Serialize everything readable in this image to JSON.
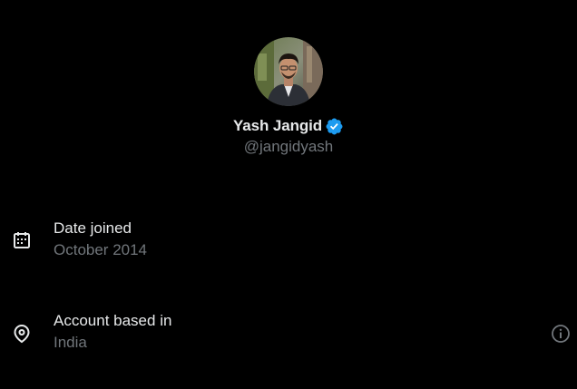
{
  "profile": {
    "display_name": "Yash Jangid",
    "handle": "@jangidyash",
    "verified": true,
    "avatar_icon": "avatar-photo"
  },
  "details": {
    "date_joined": {
      "icon": "calendar-icon",
      "label": "Date joined",
      "value": "October 2014"
    },
    "account_based_in": {
      "icon": "location-pin-icon",
      "label": "Account based in",
      "value": "India",
      "info_icon": "info-icon"
    }
  },
  "colors": {
    "background": "#000000",
    "primary_text": "#e7e9ea",
    "secondary_text": "#71767b",
    "verified_badge": "#1d9bf0"
  }
}
